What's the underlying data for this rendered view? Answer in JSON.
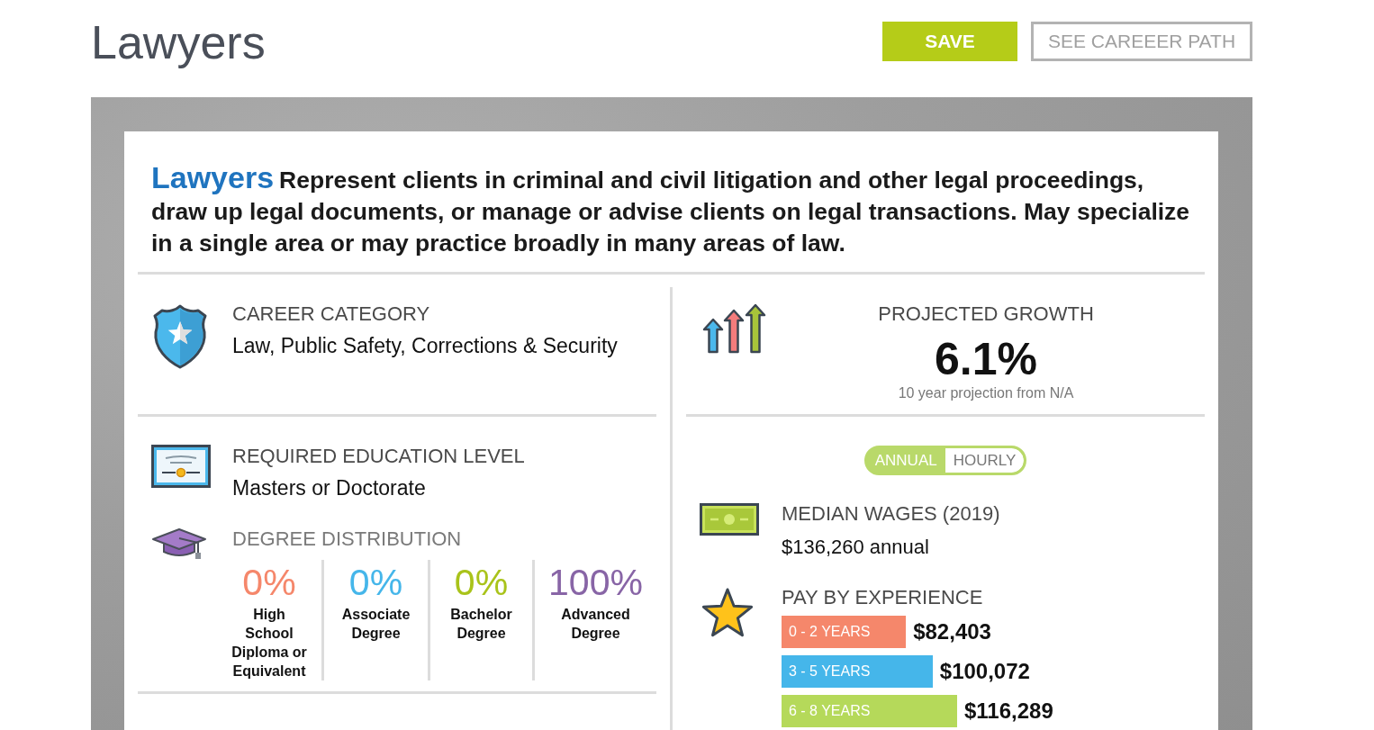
{
  "header": {
    "title": "Lawyers",
    "buttons": [
      {
        "label": "SAVE",
        "kind": "primary"
      },
      {
        "label": "SEE CAREEER PATH",
        "kind": "outline"
      }
    ]
  },
  "description": {
    "title": "Lawyers",
    "text": "Represent clients in criminal and civil litigation and other legal proceedings, draw up legal documents, or manage or advise clients on legal transactions. May specialize in a single area or may practice broadly in many areas of law."
  },
  "career_category": {
    "label": "CAREER CATEGORY",
    "value": "Law, Public Safety, Corrections & Security"
  },
  "education": {
    "label": "REQUIRED EDUCATION LEVEL",
    "value": "Masters or Doctorate"
  },
  "degree_distribution": {
    "label": "DEGREE DISTRIBUTION",
    "items": [
      {
        "percent": "0%",
        "label": "High School Diploma or Equivalent",
        "color": "#f5876b"
      },
      {
        "percent": "0%",
        "label": "Associate Degree",
        "color": "#45b6ea"
      },
      {
        "percent": "0%",
        "label": "Bachelor Degree",
        "color": "#a9c31a"
      },
      {
        "percent": "100%",
        "label": "Advanced Degree",
        "color": "#8865a6"
      }
    ]
  },
  "projected_growth": {
    "label": "PROJECTED GROWTH",
    "value": "6.1%",
    "note": "10 year projection from N/A"
  },
  "wage_toggle": {
    "options": [
      {
        "label": "ANNUAL",
        "selected": true
      },
      {
        "label": "HOURLY",
        "selected": false
      }
    ]
  },
  "median_wages": {
    "label": "MEDIAN WAGES (2019)",
    "value": "$136,260 annual"
  },
  "pay_by_experience": {
    "label": "PAY BY EXPERIENCE",
    "rows": [
      {
        "range": "0 - 2 YEARS",
        "value": "$82,403",
        "color": "#f5876b"
      },
      {
        "range": "3 - 5 YEARS",
        "value": "$100,072",
        "color": "#45b6ea"
      },
      {
        "range": "6 - 8 YEARS",
        "value": "$116,289",
        "color": "#b5d95a"
      }
    ]
  }
}
